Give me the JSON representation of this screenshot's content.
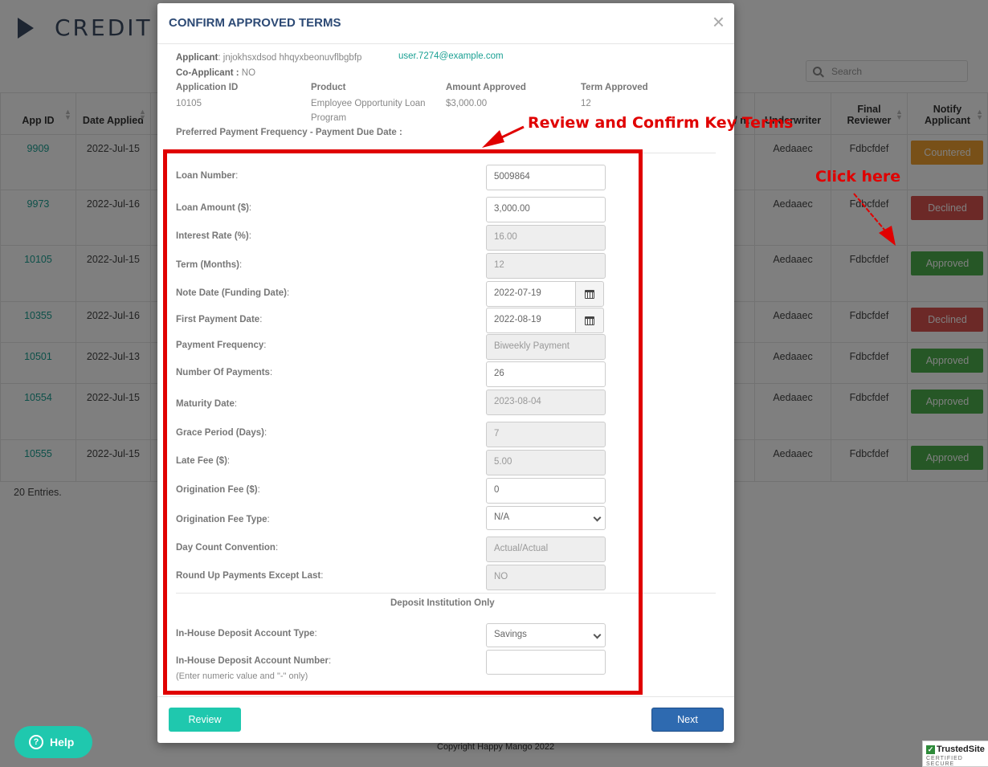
{
  "background": {
    "page_title": "CREDIT A",
    "search_placeholder": "Search",
    "columns": {
      "app_id": "App ID",
      "date_applied": "Date Applied",
      "underwriter": "Underwriter",
      "final_reviewer": "Final Reviewer",
      "notify_applicant": "Notify Applicant",
      "partial_header": "or/ nt"
    },
    "rows": [
      {
        "app_id": "9909",
        "date": "2022-Jul-15",
        "underwriter": "Aedaaec",
        "reviewer": "Fdbcfdef",
        "status": "Countered",
        "status_color": "#f0a030"
      },
      {
        "app_id": "9973",
        "date": "2022-Jul-16",
        "underwriter": "Aedaaec",
        "reviewer": "Fdbcfdef",
        "status": "Declined",
        "status_color": "#d9534f"
      },
      {
        "app_id": "10105",
        "date": "2022-Jul-15",
        "underwriter": "Aedaaec",
        "reviewer": "Fdbcfdef",
        "status": "Approved",
        "status_color": "#4cae4c"
      },
      {
        "app_id": "10355",
        "date": "2022-Jul-16",
        "underwriter": "Aedaaec",
        "reviewer": "Fdbcfdef",
        "status": "Declined",
        "status_color": "#d9534f"
      },
      {
        "app_id": "10501",
        "date": "2022-Jul-13",
        "underwriter": "Aedaaec",
        "reviewer": "Fdbcfdef",
        "status": "Approved",
        "status_color": "#4cae4c"
      },
      {
        "app_id": "10554",
        "date": "2022-Jul-15",
        "underwriter": "Aedaaec",
        "reviewer": "Fdbcfdef",
        "status": "Approved",
        "status_color": "#4cae4c"
      },
      {
        "app_id": "10555",
        "date": "2022-Jul-15",
        "underwriter": "Aedaaec",
        "reviewer": "Fdbcfdef",
        "status": "Approved",
        "status_color": "#4cae4c"
      }
    ],
    "entries_text": "20 Entries.",
    "copyright": "Copyright Happy Mango 2022",
    "help_label": "Help",
    "trusted_title": "TrustedSite",
    "trusted_sub": "CERTIFIED SECURE"
  },
  "modal": {
    "title": "CONFIRM APPROVED TERMS",
    "close_glyph": "×",
    "applicant_label": "Applicant",
    "applicant_value": ": jnjokhsxdsod hhqyxbeonuvflbgbfp",
    "email": "user.7274@example.com",
    "coapplicant_label": "Co-Applicant :",
    "coapplicant_value": " NO",
    "application_id_label": "Application ID",
    "application_id": "10105",
    "product_label": "Product",
    "product_line1": "Employee Opportunity Loan",
    "product_line2": "Program",
    "amount_label": "Amount Approved",
    "amount_value": "$3,000.00",
    "term_label": "Term Approved",
    "term_value": "12",
    "preferred_label": "Preferred Payment Frequency - Payment Due Date :",
    "fields": {
      "loan_number": {
        "label": "Loan Number",
        "value": "5009864"
      },
      "loan_amount": {
        "label": "Loan Amount ($)",
        "value": "3,000.00"
      },
      "interest_rate": {
        "label": "Interest Rate (%)",
        "value": "16.00"
      },
      "term_months": {
        "label": "Term (Months)",
        "value": "12"
      },
      "note_date": {
        "label": "Note Date (Funding Date)",
        "value": "2022-07-19"
      },
      "first_payment": {
        "label": "First Payment Date",
        "value": "2022-08-19"
      },
      "payment_frequency": {
        "label": "Payment Frequency",
        "value": "Biweekly Payment"
      },
      "number_payments": {
        "label": "Number Of Payments",
        "value": "26"
      },
      "maturity_date": {
        "label": "Maturity Date",
        "value": "2023-08-04"
      },
      "grace_period": {
        "label": "Grace Period (Days)",
        "value": "7"
      },
      "late_fee": {
        "label": "Late Fee ($)",
        "value": "5.00"
      },
      "origination_fee": {
        "label": "Origination Fee ($)",
        "value": "0"
      },
      "origination_fee_type": {
        "label": "Origination Fee Type",
        "value": "N/A"
      },
      "day_count": {
        "label": "Day Count Convention",
        "value": "Actual/Actual"
      },
      "round_up": {
        "label": "Round Up Payments Except Last",
        "value": "NO"
      },
      "deposit_type": {
        "label": "In-House Deposit Account Type",
        "value": "Savings"
      },
      "deposit_number": {
        "label": "In-House Deposit Account Number",
        "value": ""
      }
    },
    "deposit_section_title": "Deposit Institution Only",
    "deposit_note": "(Enter numeric value and \"-\" only)",
    "review_button": "Review",
    "next_button": "Next"
  },
  "annotations": {
    "review_text": "Review and Confirm Key Terms",
    "click_text": "Click here",
    "color": "#e00000"
  }
}
